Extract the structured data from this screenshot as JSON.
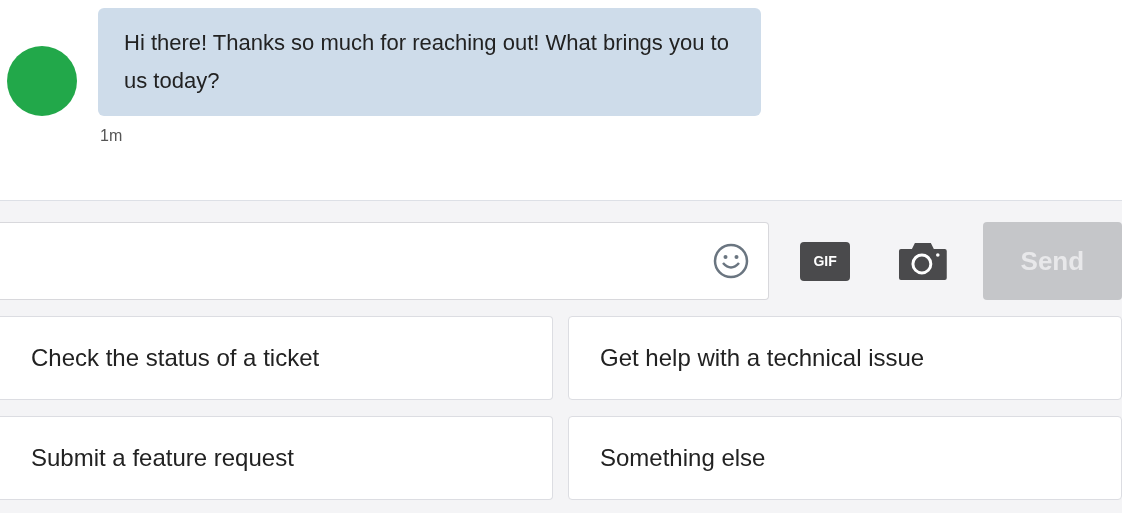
{
  "message": {
    "text": "Hi there! Thanks so much for reaching out! What brings you to us today?",
    "time": "1m"
  },
  "composer": {
    "gif_label": "GIF",
    "send": {
      "label": "Send",
      "disabled": true
    }
  },
  "quick_replies": [
    {
      "label": "Check the status of a ticket"
    },
    {
      "label": "Get help with a technical issue"
    },
    {
      "label": "Submit a feature request"
    },
    {
      "label": "Something else"
    }
  ]
}
